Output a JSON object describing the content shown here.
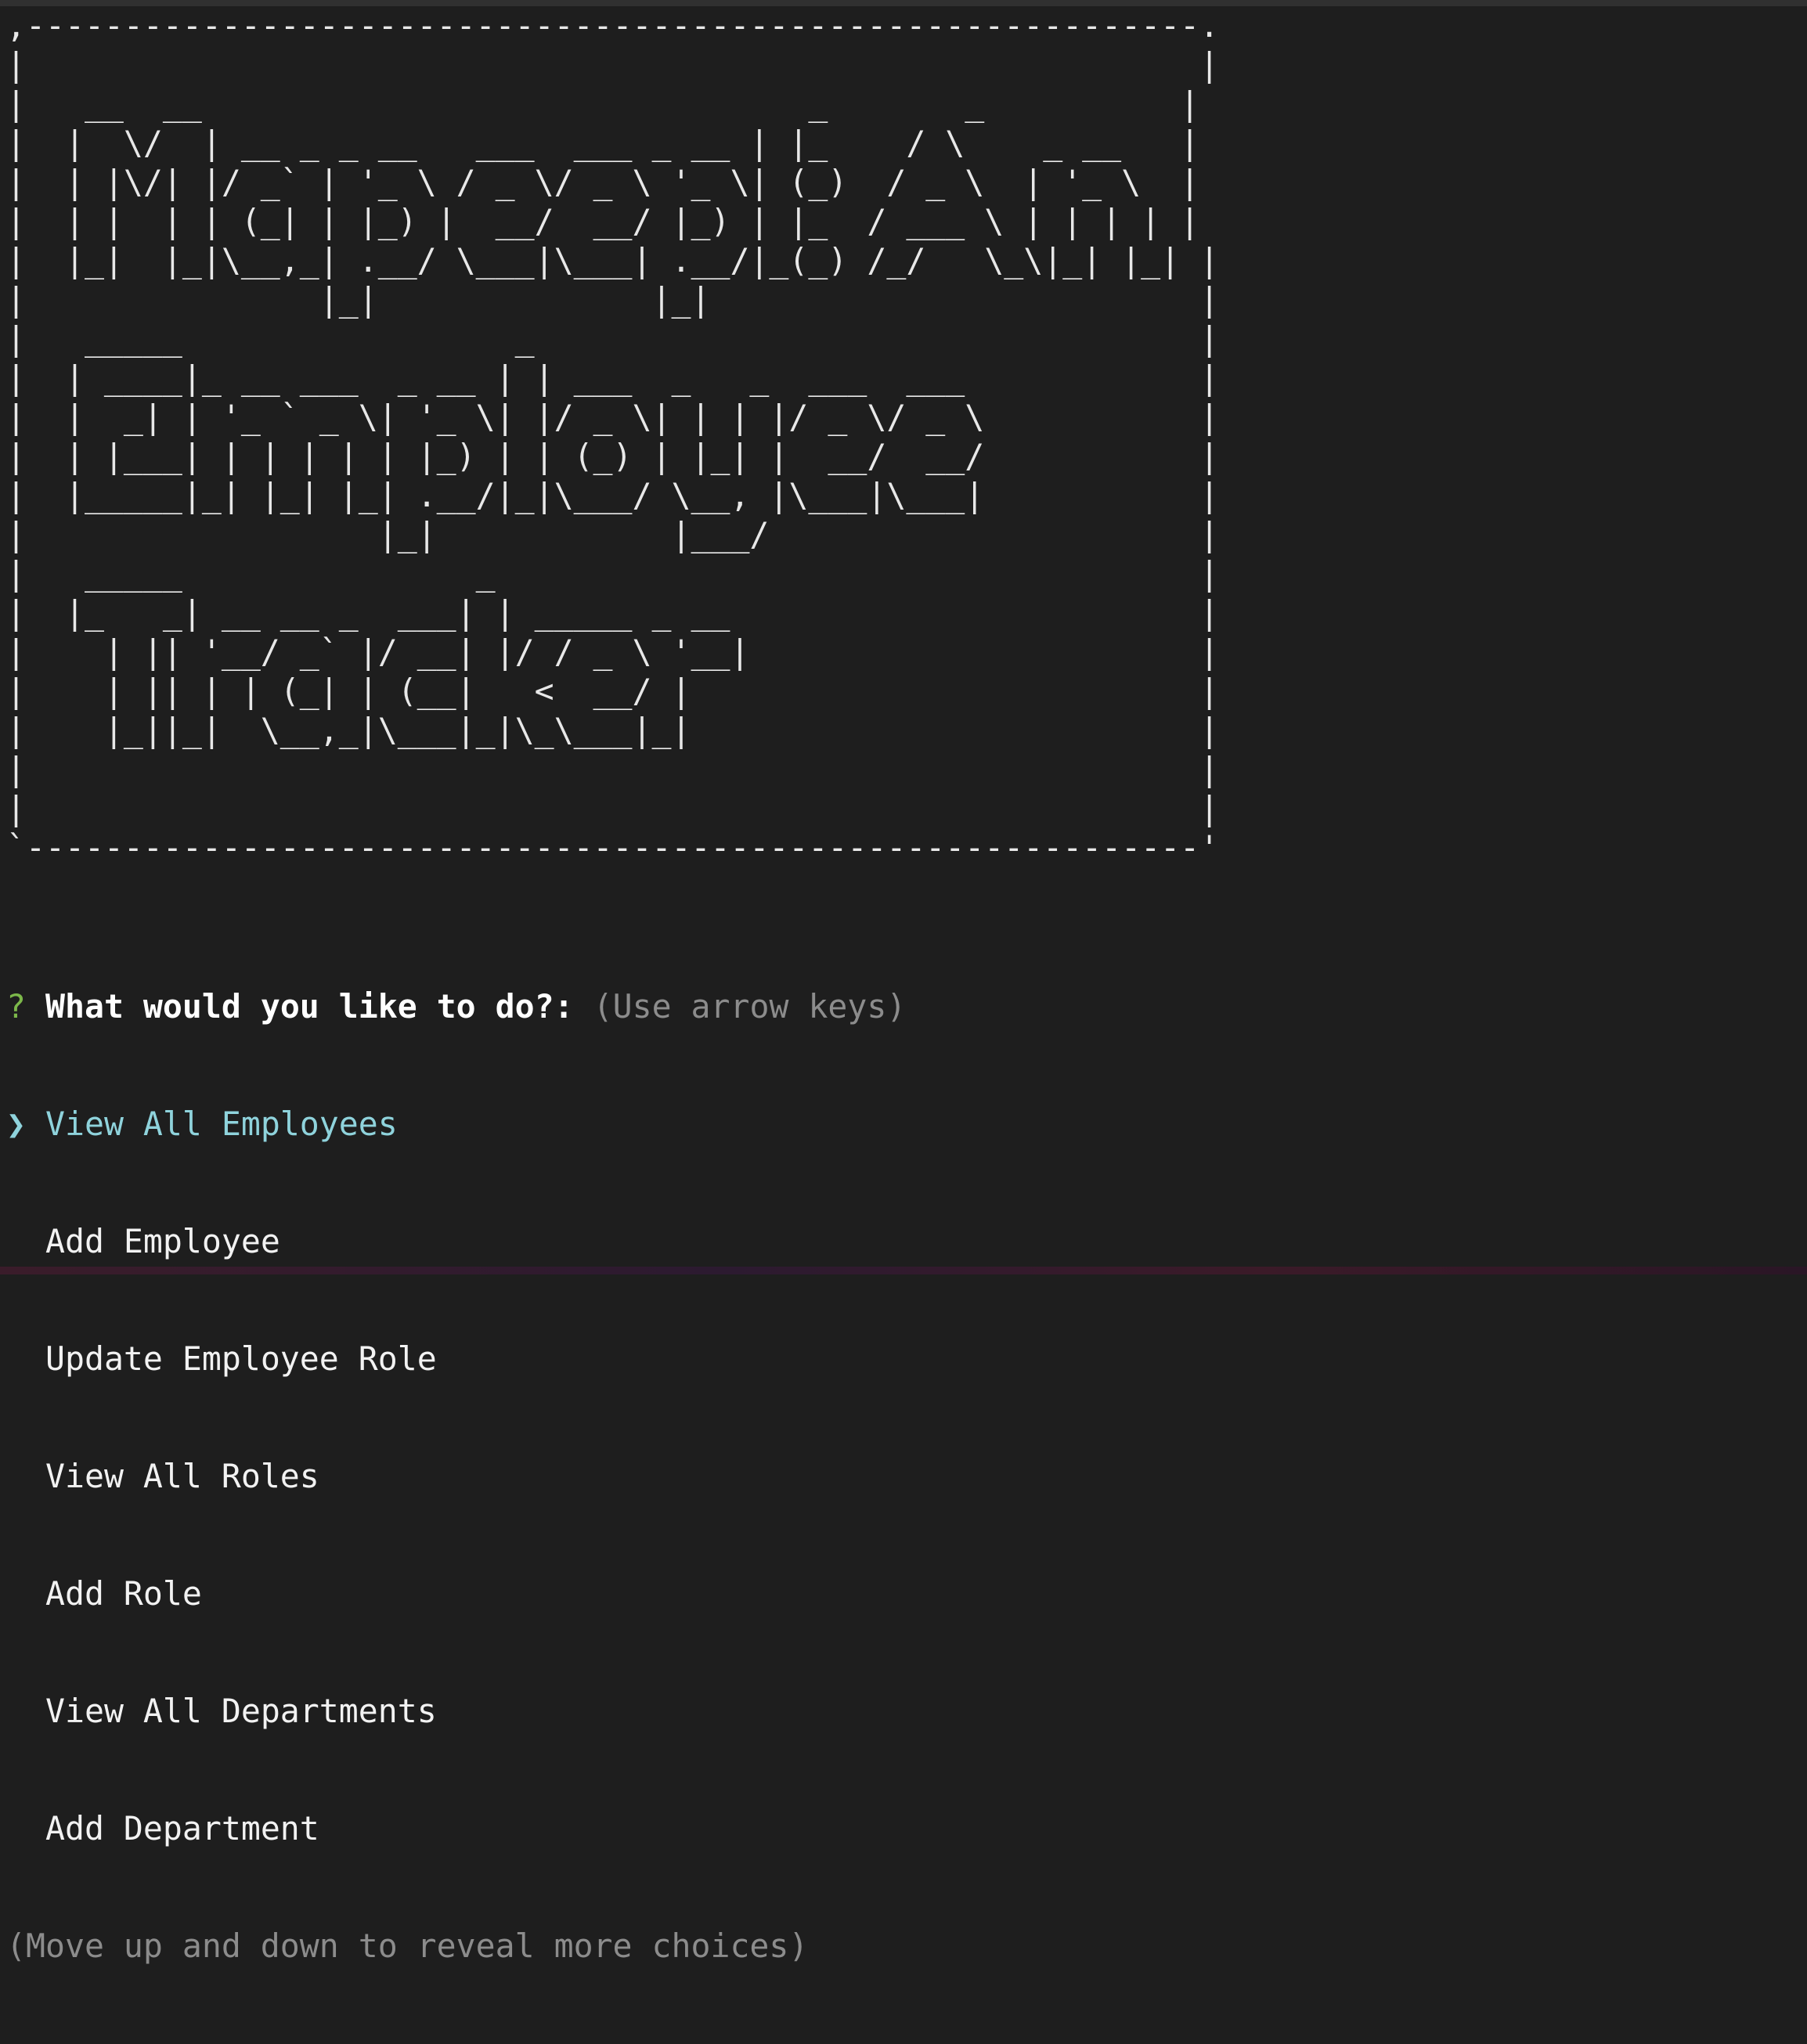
{
  "banner": {
    "lines": [
      ",------------------------------------------------------------.",
      "|                                                            |",
      "|   __  __                               _       _          |",
      "|  |  \\/  | __ _ _ __   ___  ___ _ __ | |_    / \\    _ __   |",
      "|  | |\\/| |/ _` | '_ \\ / _ \\/ _ \\ '_ \\| (_)  / _ \\  | '_ \\  |",
      "|  | |  | | (_| | |_) |  __/  __/ |_) | |_  / ___ \\ | | | | |",
      "|  |_|  |_|\\__,_| .__/ \\___|\\___| .__/|_(_) /_/   \\_\\|_| |_| |",
      "|               |_|              |_|                         |",
      "|   _____                 _                                  |",
      "|  | ____|_ __ ___  _ __ | | ___  _   _  ___  ___            |",
      "|  |  _| | '_ ` _ \\| '_ \\| |/ _ \\| | | |/ _ \\/ _ \\           |",
      "|  | |___| | | | | | |_) | | (_) | |_| |  __/  __/           |",
      "|  |_____|_| |_| |_| .__/|_|\\___/ \\__, |\\___|\\___|           |",
      "|                  |_|            |___/                      |",
      "|   _____               _                                    |",
      "|  |_   _| __ __ _  ___| | _____ _ __                        |",
      "|    | || '__/ _` |/ __| |/ / _ \\ '__|                       |",
      "|    | || | | (_| | (__|   <  __/ |                          |",
      "|    |_||_|  \\__,_|\\___|_|\\_\\___|_|                          |",
      "|                                                            |",
      "|                                                            |",
      "`------------------------------------------------------------'"
    ]
  },
  "prompt": {
    "marker": "?",
    "question": "What would you like to do?:",
    "hint": "(Use arrow keys)",
    "pointer": "❯",
    "selected_index": 0,
    "choices": [
      "View All Employees",
      "Add Employee",
      "Update Employee Role",
      "View All Roles",
      "Add Role",
      "View All Departments",
      "Add Department"
    ],
    "footer": "(Move up and down to reveal more choices)"
  },
  "colors": {
    "background": "#1e1e1e",
    "marker": "#7cb84a",
    "selected": "#8fd3dc",
    "hint": "#8c8c8c",
    "text": "#f2f2f2"
  }
}
